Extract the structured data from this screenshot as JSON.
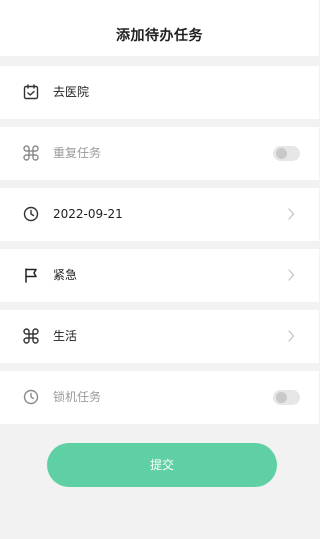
{
  "header": {
    "title": "添加待办任务"
  },
  "rows": [
    {
      "label": "去医院",
      "icon": "calendar-check-icon"
    },
    {
      "label": "重复任务",
      "icon": "clover-icon"
    },
    {
      "label": "2022-09-21",
      "icon": "clock-icon"
    },
    {
      "label": "紧急",
      "icon": "flag-icon"
    },
    {
      "label": "生活",
      "icon": "clover-icon"
    },
    {
      "label": "锁机任务",
      "icon": "clock-icon"
    }
  ],
  "toggles": {
    "repeat_task": false,
    "lock_task": false
  },
  "submit_label": "提交",
  "colors": {
    "accent": "#5fd0a3",
    "background": "#f2f2f2"
  }
}
